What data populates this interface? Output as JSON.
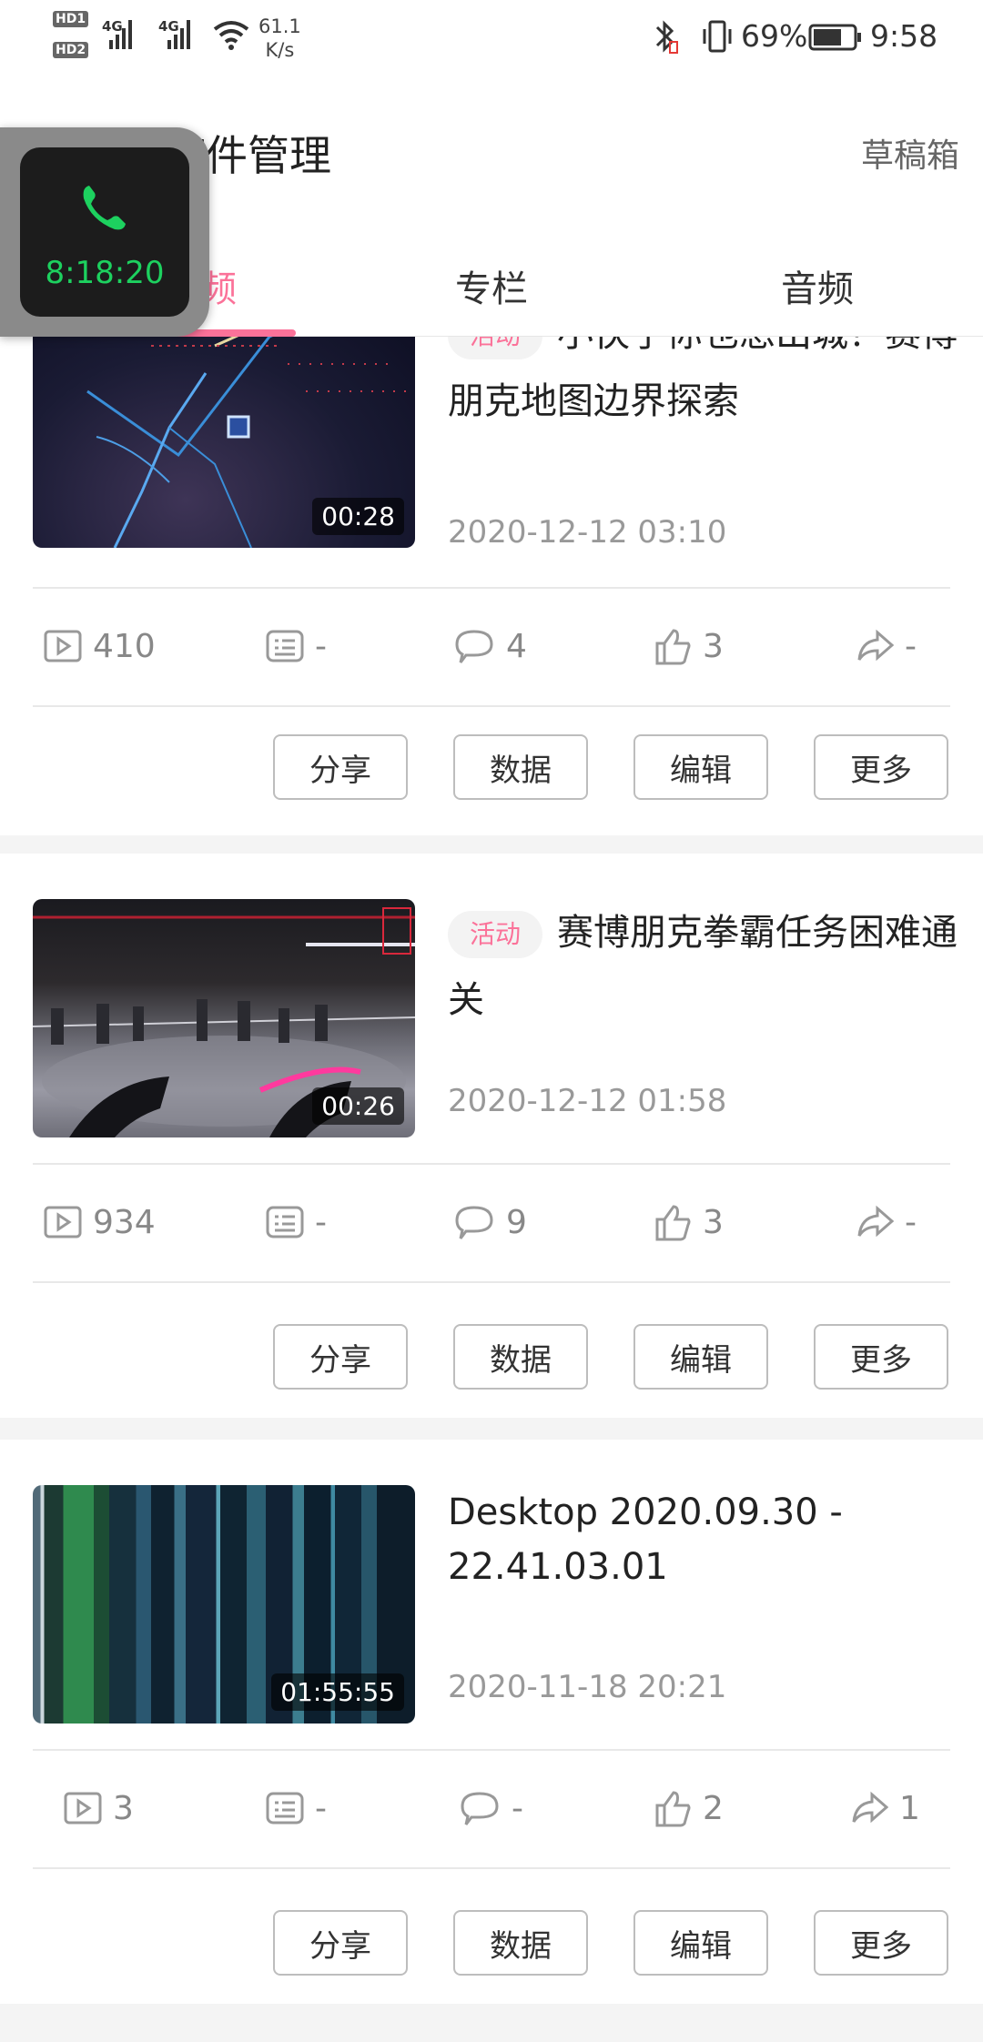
{
  "status_bar": {
    "hd1": "HD",
    "hd1_sub": "1",
    "hd2": "HD",
    "hd2_sub": "2",
    "net1": "4G",
    "net2": "4G",
    "speed_value": "61.1",
    "speed_unit": "K/s",
    "battery_percent": "69%",
    "time": "9:58"
  },
  "header": {
    "title": "稿件管理",
    "drafts_label": "草稿箱",
    "tabs": [
      {
        "label": "视频",
        "active": true
      },
      {
        "label": "专栏",
        "active": false
      },
      {
        "label": "音频",
        "active": false
      }
    ],
    "accent_color": "#fb7299"
  },
  "call_overlay": {
    "timer": "8:18:20",
    "icon": "phone-icon",
    "color": "#1dd15f"
  },
  "videos": [
    {
      "tag": "活动",
      "title": "小伙子你也想出城？赛博朋克地图边界探索",
      "duration": "00:28",
      "datetime": "2020-12-12 03:10",
      "stats": {
        "plays": "410",
        "danmaku": "-",
        "comments": "4",
        "likes": "3",
        "shares": "-"
      }
    },
    {
      "tag": "活动",
      "title": "赛博朋克拳霸任务困难通关",
      "duration": "00:26",
      "datetime": "2020-12-12 01:58",
      "stats": {
        "plays": "934",
        "danmaku": "-",
        "comments": "9",
        "likes": "3",
        "shares": "-"
      }
    },
    {
      "tag": "",
      "title": "Desktop 2020.09.30 - 22.41.03.01",
      "duration": "01:55:55",
      "datetime": "2020-11-18 20:21",
      "stats": {
        "plays": "3",
        "danmaku": "-",
        "comments": "-",
        "likes": "2",
        "shares": "1"
      }
    }
  ],
  "actions": {
    "share": "分享",
    "data": "数据",
    "edit": "编辑",
    "more": "更多"
  }
}
